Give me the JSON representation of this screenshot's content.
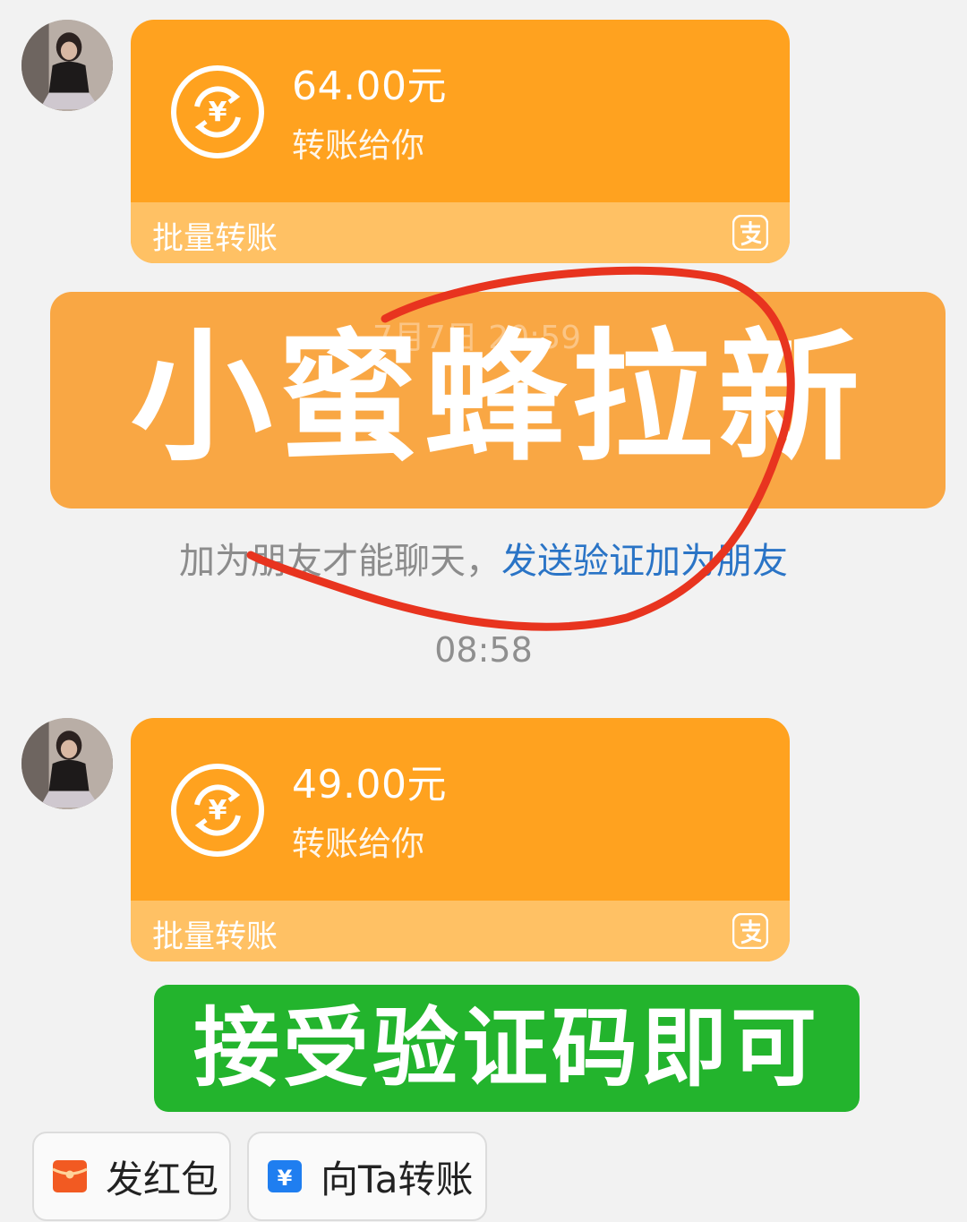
{
  "messages": [
    {
      "type": "transfer",
      "amount": "64.00元",
      "desc": "转账给你",
      "footer_label": "批量转账",
      "footer_icon": "alipay-icon"
    },
    {
      "type": "transfer",
      "amount": "49.00元",
      "desc": "转账给你",
      "footer_label": "批量转账",
      "footer_icon": "alipay-icon"
    }
  ],
  "overlay_banner": {
    "title": "小蜜蜂拉新",
    "ghost_time": "7月7日 20:59"
  },
  "notice": {
    "text": "加为朋友才能聊天，",
    "link": "发送验证加为朋友"
  },
  "timestamp": "08:58",
  "green_banner": {
    "text": "接受验证码即可"
  },
  "actions": [
    {
      "label": "发红包",
      "icon": "red-packet-icon"
    },
    {
      "label": "向Ta转账",
      "icon": "transfer-icon"
    }
  ],
  "colors": {
    "card": "#ffa21f",
    "card_footer": "#ffc164",
    "promo": "#f9a744",
    "green": "#23b42d",
    "link": "#2a74c6",
    "scribble": "#e8341f"
  }
}
